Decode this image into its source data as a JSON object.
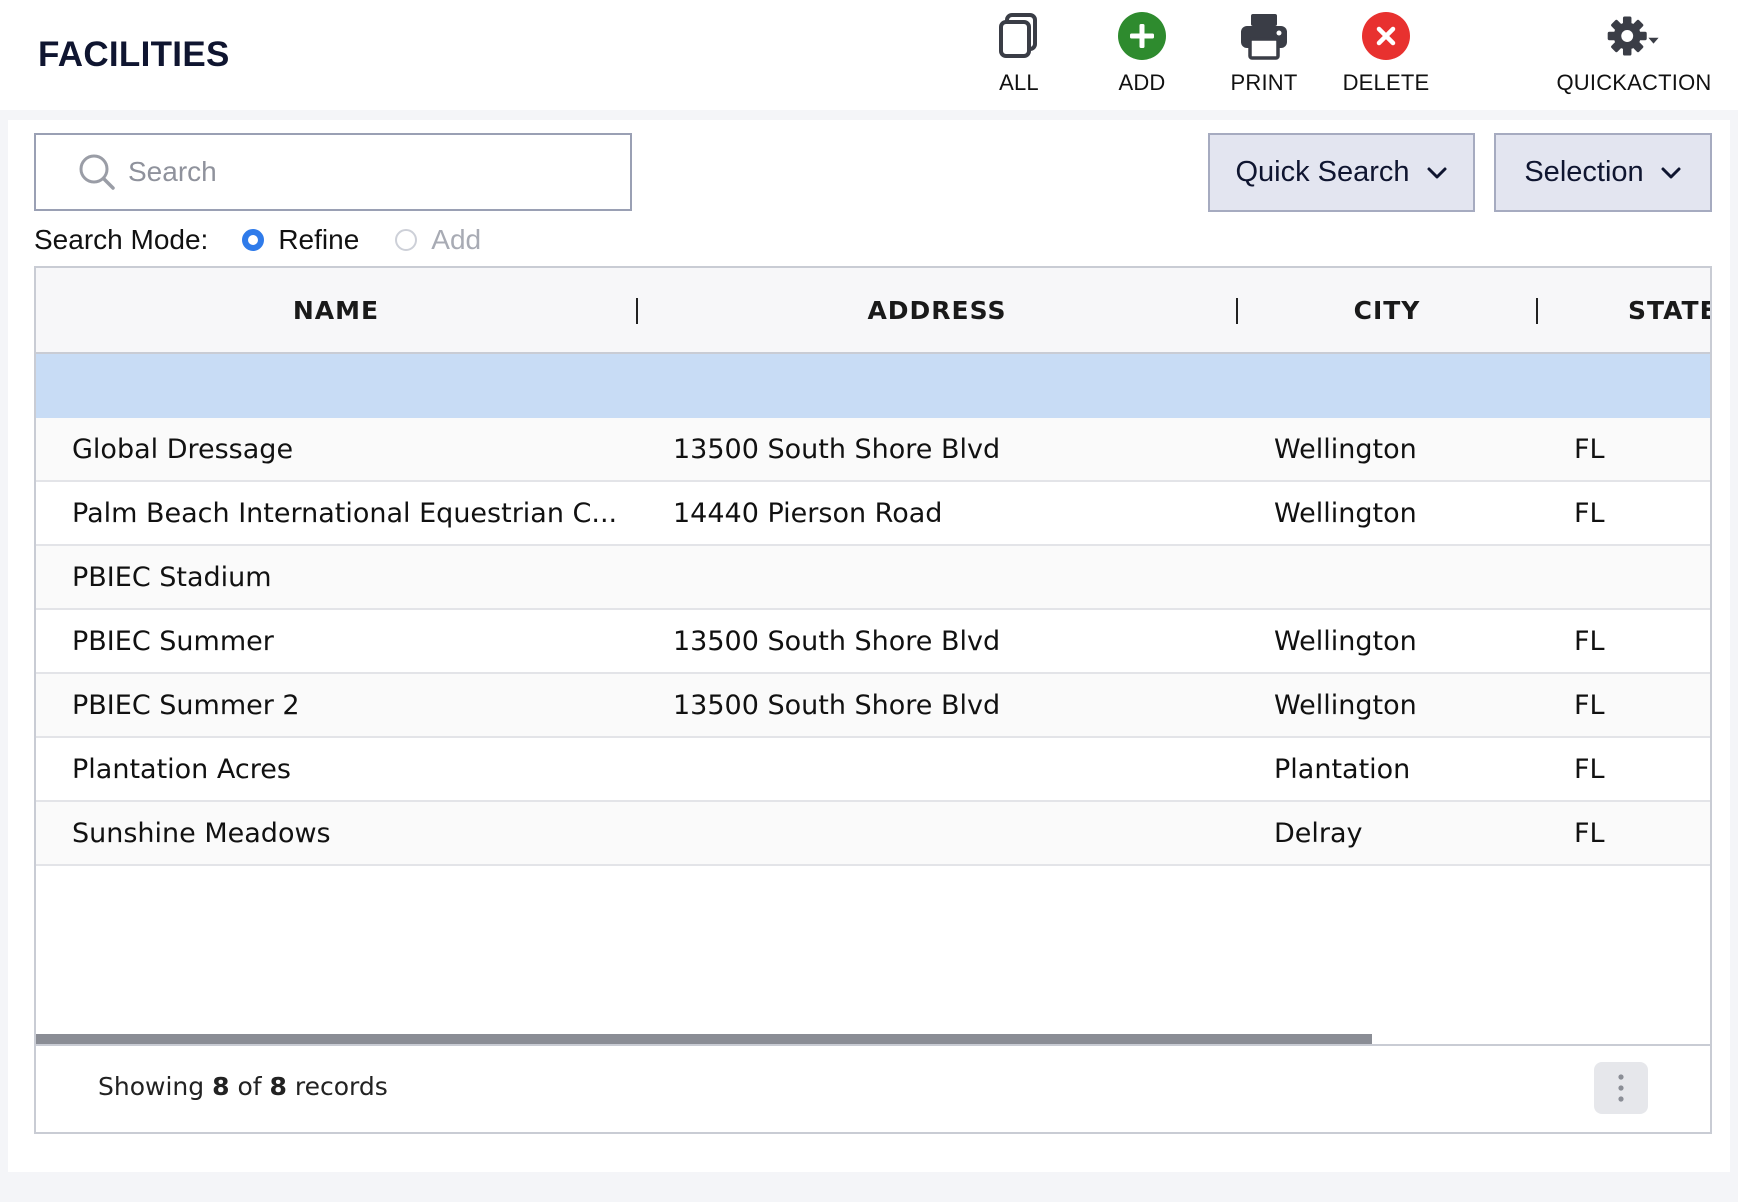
{
  "header": {
    "title": "FACILITIES",
    "tools": {
      "all": "ALL",
      "add": "ADD",
      "print": "PRINT",
      "delete": "DELETE",
      "quickaction": "QUICKACTION"
    }
  },
  "search": {
    "placeholder": "Search",
    "value": ""
  },
  "buttons": {
    "quick_search": "Quick Search",
    "selection": "Selection"
  },
  "search_mode": {
    "label": "Search Mode:",
    "options": [
      "Refine",
      "Add"
    ],
    "selected": "Refine"
  },
  "table": {
    "columns": [
      "NAME",
      "ADDRESS",
      "CITY",
      "STATE"
    ],
    "rows": [
      {
        "name": "Global Dressage",
        "address": "13500 South Shore Blvd",
        "city": "Wellington",
        "state": "FL"
      },
      {
        "name": "Palm Beach International Equestrian C...",
        "address": "14440 Pierson Road",
        "city": "Wellington",
        "state": "FL"
      },
      {
        "name": "PBIEC Stadium",
        "address": "",
        "city": "",
        "state": ""
      },
      {
        "name": "PBIEC Summer",
        "address": "13500 South Shore Blvd",
        "city": "Wellington",
        "state": "FL"
      },
      {
        "name": "PBIEC Summer 2",
        "address": "13500 South Shore Blvd",
        "city": "Wellington",
        "state": "FL"
      },
      {
        "name": "Plantation Acres",
        "address": "",
        "city": "Plantation",
        "state": "FL"
      },
      {
        "name": "Sunshine Meadows",
        "address": "",
        "city": "Delray",
        "state": "FL"
      }
    ]
  },
  "footer": {
    "showing_prefix": "Showing",
    "shown_count": "8",
    "of_word": "of",
    "total_count": "8",
    "records_word": "records"
  },
  "colors": {
    "add_green": "#2e8b2e",
    "delete_red": "#e8312f",
    "selected_row": "#c8dcf5",
    "radio_blue": "#2f7bea"
  }
}
